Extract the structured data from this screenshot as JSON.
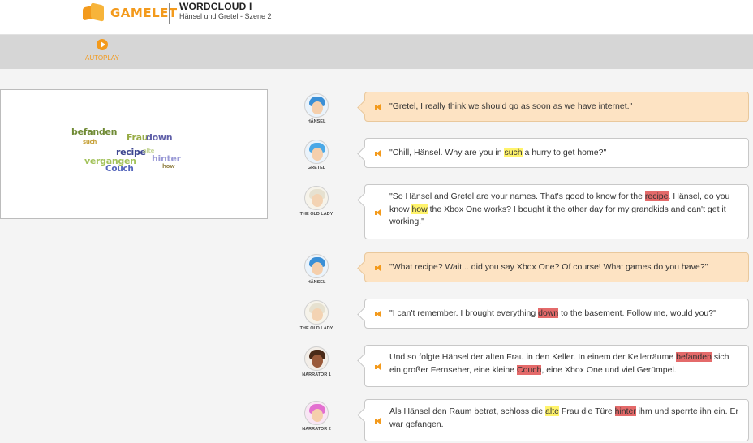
{
  "header": {
    "logo_text": "GAMELET",
    "title": "WORDCLOUD I",
    "subtitle": "Hänsel und Gretel - Szene 2"
  },
  "toolbar": {
    "autoplay_label": "AUTOPLAY"
  },
  "wordcloud": {
    "words": [
      {
        "text": "befanden",
        "color": "#6f8a34"
      },
      {
        "text": "Frau",
        "color": "#98ac46"
      },
      {
        "text": "down",
        "color": "#5e5ea8"
      },
      {
        "text": "such",
        "color": "#c7a23a"
      },
      {
        "text": "recipe",
        "color": "#3d4690"
      },
      {
        "text": "alte",
        "color": "#c7d79b"
      },
      {
        "text": "vergangen",
        "color": "#a2c25a"
      },
      {
        "text": "Couch",
        "color": "#5667bd"
      },
      {
        "text": "hinter",
        "color": "#9a9ad6"
      },
      {
        "text": "how",
        "color": "#9a8a52"
      }
    ]
  },
  "dialogue": [
    {
      "speaker": "HÄNSEL",
      "style": "orange",
      "parts": [
        {
          "t": "\"Gretel, I really think we should go as soon as we have internet.\""
        }
      ]
    },
    {
      "speaker": "GRETEL",
      "style": "white",
      "parts": [
        {
          "t": "\"Chill, Hänsel. Why are you in "
        },
        {
          "t": "such",
          "hl": "y"
        },
        {
          "t": " a hurry to get home?\""
        }
      ]
    },
    {
      "speaker": "THE OLD LADY",
      "style": "white",
      "parts": [
        {
          "t": "\"So Hänsel and Gretel are your names. That's good to know for the "
        },
        {
          "t": "recipe",
          "hl": "r"
        },
        {
          "t": ". Hänsel, do you know "
        },
        {
          "t": "how",
          "hl": "y"
        },
        {
          "t": " the Xbox One works? I bought it the other day for my grandkids and can't get it working.\""
        }
      ]
    },
    {
      "speaker": "HÄNSEL",
      "style": "orange",
      "parts": [
        {
          "t": "\"What recipe? Wait... did you say Xbox One? Of course! What games do you have?\""
        }
      ]
    },
    {
      "speaker": "THE OLD LADY",
      "style": "white",
      "parts": [
        {
          "t": "\"I can't remember. I brought everything "
        },
        {
          "t": "down",
          "hl": "r"
        },
        {
          "t": " to the basement. Follow me, would you?\""
        }
      ]
    },
    {
      "speaker": "NARRATOR 1",
      "style": "white",
      "parts": [
        {
          "t": "Und so folgte Hänsel der alten Frau in den Keller. In einem der Kellerräume "
        },
        {
          "t": "befanden",
          "hl": "r"
        },
        {
          "t": " sich ein großer Fernseher, eine kleine "
        },
        {
          "t": "Couch",
          "hl": "r"
        },
        {
          "t": ", eine Xbox One und viel Gerümpel."
        }
      ]
    },
    {
      "speaker": "NARRATOR 2",
      "style": "white",
      "parts": [
        {
          "t": "Als Hänsel den Raum betrat, schloss die "
        },
        {
          "t": "alte",
          "hl": "y"
        },
        {
          "t": " Frau die Türe "
        },
        {
          "t": "hinter",
          "hl": "r"
        },
        {
          "t": " ihm und sperrte ihn ein. Er war gefangen."
        }
      ]
    }
  ]
}
